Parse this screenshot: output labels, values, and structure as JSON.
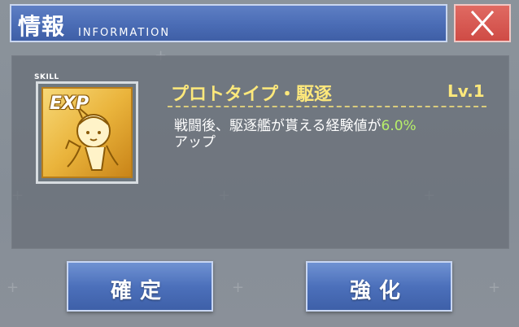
{
  "title": {
    "main": "情報",
    "sub": "INFORMATION"
  },
  "close": {
    "icon": "close-icon"
  },
  "skill": {
    "tag": "SKILL",
    "icon_label": "EXP",
    "name": "プロトタイプ・駆逐",
    "level": "Lv.1",
    "desc_prefix": "戦闘後、駆逐艦が貰える経験値が",
    "desc_value": "6.0%",
    "desc_suffix": "アップ"
  },
  "buttons": {
    "confirm": "確定",
    "enhance": "強化"
  },
  "colors": {
    "accent_yellow": "#fde87b",
    "highlight_green": "#b7ef6a",
    "title_blue": "#4a6cb5",
    "close_red": "#d3504a"
  }
}
